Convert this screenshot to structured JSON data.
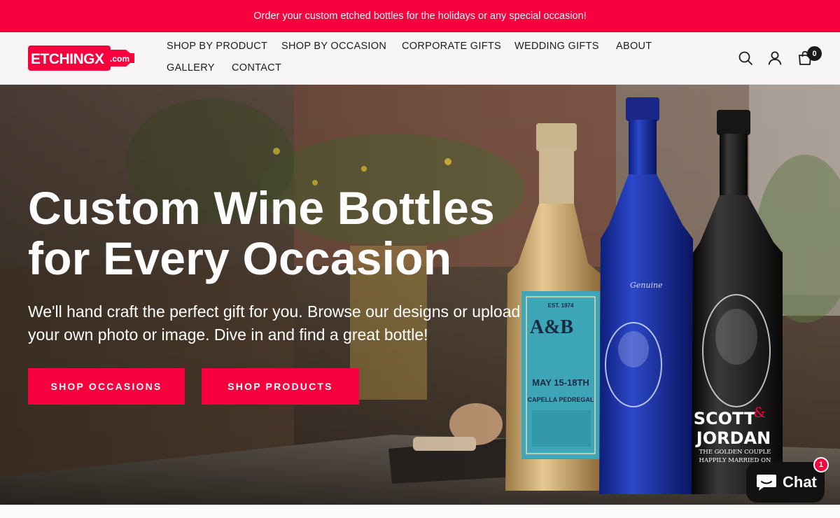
{
  "announcement": {
    "text": "Order your custom etched bottles for the holidays or any special occasion!"
  },
  "header": {
    "logo_text": "ETCHINGX",
    "logo_suffix": ".com",
    "nav": [
      {
        "label": "SHOP BY PRODUCT"
      },
      {
        "label": "SHOP BY OCCASION"
      },
      {
        "label": "CORPORATE GIFTS"
      },
      {
        "label": "WEDDING GIFTS"
      },
      {
        "label": "ABOUT"
      },
      {
        "label": "GALLERY"
      },
      {
        "label": "CONTACT"
      }
    ],
    "icons": {
      "search": "search-icon",
      "account": "user-icon",
      "cart": "cart-icon"
    },
    "cart_count": "0"
  },
  "hero": {
    "title_line1": "Custom Wine Bottles",
    "title_line2": "for Every Occasion",
    "subtitle": "We'll hand craft the perfect gift for you. Browse our designs or upload your own photo or image. Dive in and find a great bottle!",
    "buttons": [
      {
        "label": "SHOP OCCASIONS"
      },
      {
        "label": "SHOP PRODUCTS"
      }
    ],
    "bottle_labels": {
      "tequila_est": "EST. 1974",
      "tequila_initials": "A&B",
      "tequila_date": "MAY 15-18TH",
      "tequila_place": "CAPELLA PEDREGAL",
      "blue_text": "Genuine",
      "black_name1": "SCOTT",
      "black_amp": "&",
      "black_name2": "JORDAN",
      "black_line1": "THE GOLDEN COUPLE",
      "black_line2": "HAPPILY MARRIED ON"
    }
  },
  "chat": {
    "label": "Chat",
    "badge": "1"
  },
  "colors": {
    "accent": "#f8003d",
    "header_bg": "#f7f6f4",
    "dark": "#1c1b1b"
  }
}
